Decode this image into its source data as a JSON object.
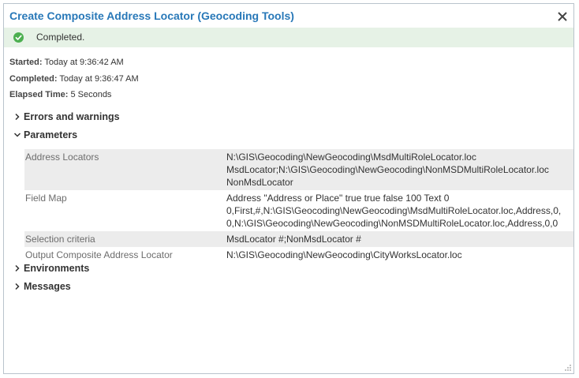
{
  "window": {
    "title": "Create Composite Address Locator (Geocoding Tools)"
  },
  "status": {
    "text": "Completed.",
    "color": "#4caf50",
    "icon": "check-circle-icon"
  },
  "info": {
    "started_label": "Started:",
    "started_value": "Today at 9:36:42 AM",
    "completed_label": "Completed:",
    "completed_value": "Today at 9:36:47 AM",
    "elapsed_label": "Elapsed Time:",
    "elapsed_value": "5 Seconds"
  },
  "sections": {
    "errors": {
      "label": "Errors and warnings",
      "expanded": false
    },
    "parameters": {
      "label": "Parameters",
      "expanded": true
    },
    "environments": {
      "label": "Environments",
      "expanded": false
    },
    "messages": {
      "label": "Messages",
      "expanded": false
    }
  },
  "parameters": [
    {
      "name": "Address Locators",
      "value": "N:\\GIS\\Geocoding\\NewGeocoding\\MsdMultiRoleLocator.loc MsdLocator;N:\\GIS\\Geocoding\\NewGeocoding\\NonMSDMultiRoleLocator.loc NonMsdLocator"
    },
    {
      "name": "Field Map",
      "value": "Address \"Address or Place\" true true false 100 Text 0 0,First,#,N:\\GIS\\Geocoding\\NewGeocoding\\MsdMultiRoleLocator.loc,Address,0,0,N:\\GIS\\Geocoding\\NewGeocoding\\NonMSDMultiRoleLocator.loc,Address,0,0"
    },
    {
      "name": "Selection criteria",
      "value": "MsdLocator #;NonMsdLocator #"
    },
    {
      "name": "Output Composite Address Locator",
      "value": "N:\\GIS\\Geocoding\\NewGeocoding\\CityWorksLocator.loc"
    }
  ],
  "colors": {
    "title": "#2878b8",
    "status_bg": "#e6f2e6",
    "row_shade": "#ececec"
  }
}
